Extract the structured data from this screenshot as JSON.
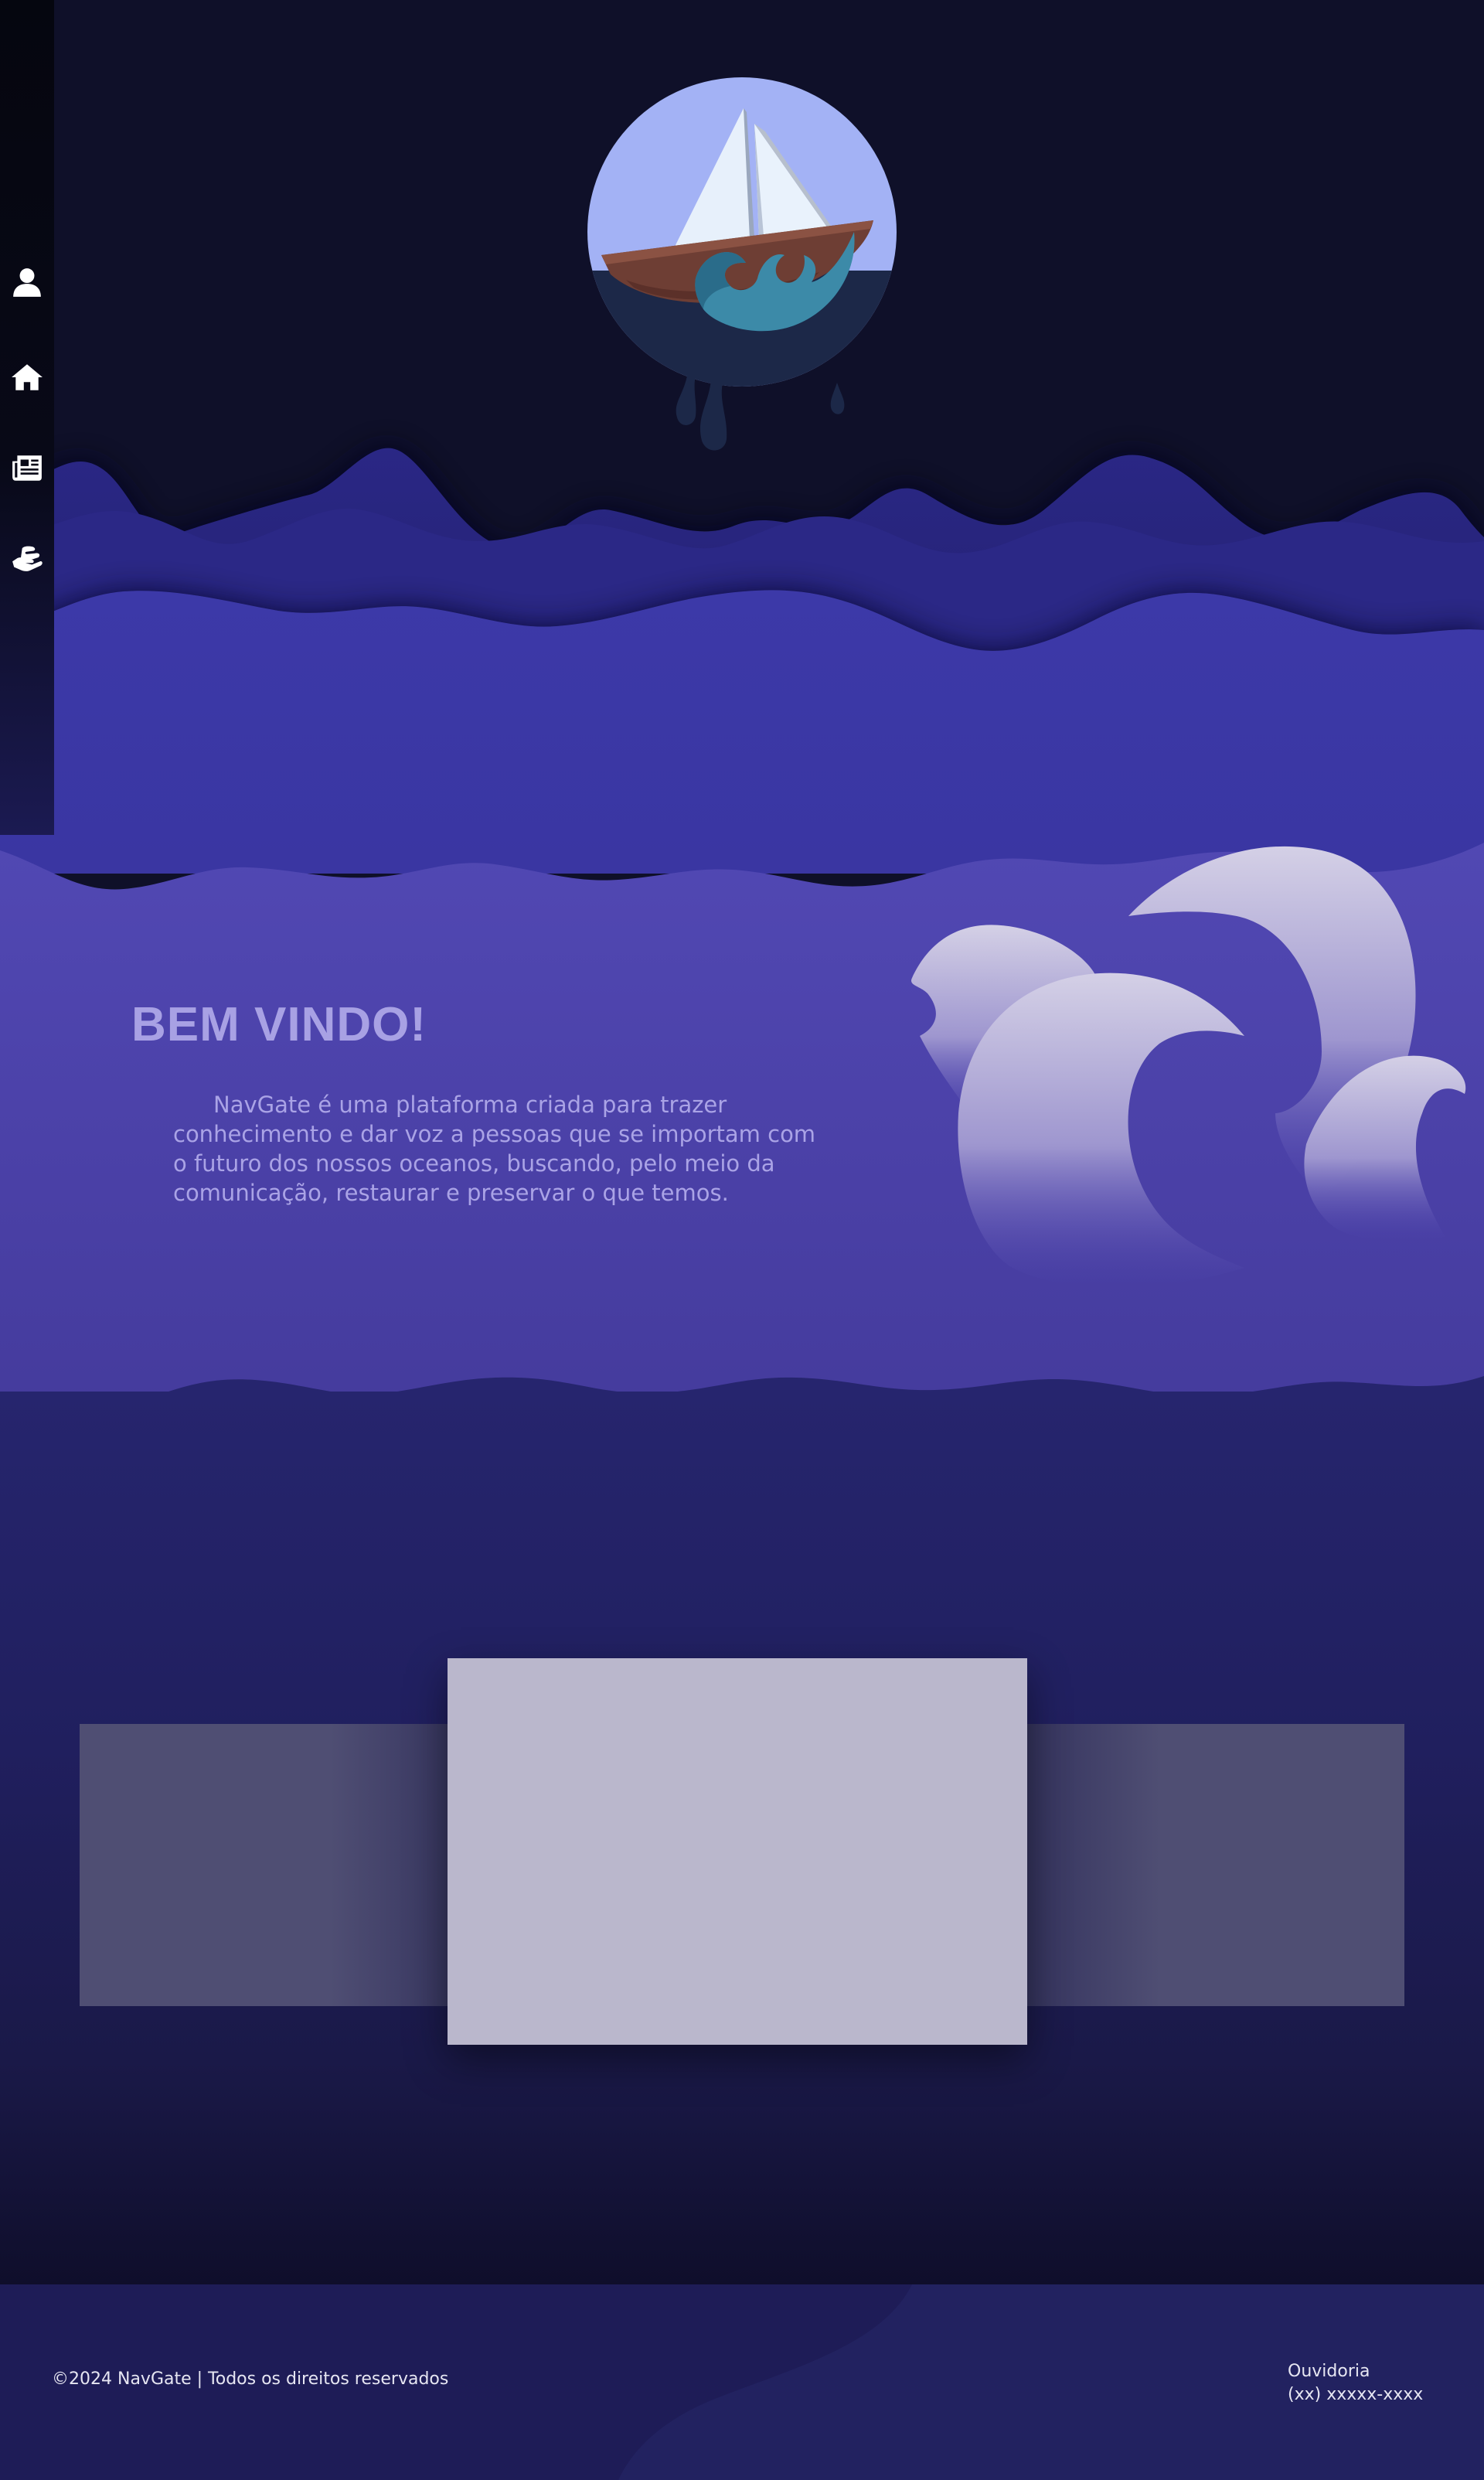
{
  "sidebar": {
    "items": [
      {
        "name": "profile",
        "icon": "user-icon"
      },
      {
        "name": "home",
        "icon": "home-icon"
      },
      {
        "name": "news",
        "icon": "newspaper-icon"
      },
      {
        "name": "support",
        "icon": "hand-holding-icon"
      }
    ]
  },
  "hero": {
    "logo_icon": "sailboat-logo"
  },
  "welcome": {
    "title": "BEM VINDO!",
    "text": "NavGate é uma plataforma criada para trazer conhecimento e dar voz a pessoas que se importam com o futuro dos nossos oceanos, buscando, pelo meio da comunicação, restaurar e preservar o que temos."
  },
  "carousel": {
    "slides": [
      "left",
      "center",
      "right"
    ]
  },
  "footer": {
    "copyright": "©2024 NavGate | Todos os direitos reservados",
    "ouvidoria_label": "Ouvidoria",
    "ouvidoria_phone": "(xx) xxxxx-xxxx"
  },
  "colors": {
    "background": "#0f1029",
    "wave_dark": "#26257f",
    "wave_mid": "#3b38a6",
    "wave_light": "#4f46b0",
    "title": "#a8a1e4",
    "slide_center": "#bab7cc",
    "slide_side": "#4f4e73",
    "footer": "#1e1c57"
  }
}
